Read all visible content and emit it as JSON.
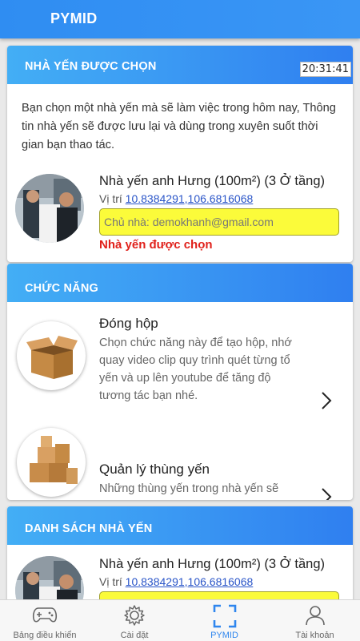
{
  "app": {
    "title": "PYMID"
  },
  "selected_card": {
    "header": "NHÀ YẾN ĐƯỢC CHỌN",
    "clock": "20:31:41",
    "intro": "Bạn chọn một nhà yến mà sẽ làm việc trong hôm nay, Thông tin nhà yến sẽ được lưu lại và dùng trong xuyên suốt thời gian bạn thao tác.",
    "house": {
      "name": "Nhà yến anh Hưng (100m²) (3 Ở tầng)",
      "location_label": "Vị trí",
      "lat": "10.8384291",
      "lng": "106.6816068",
      "owner": "Chủ nhà: demokhanh@gmail.com",
      "status": "Nhà yến được chọn"
    }
  },
  "features_card": {
    "header": "CHỨC NĂNG",
    "items": [
      {
        "title": "Đóng hộp",
        "desc": "Chọn chức năng này để tạo hộp, nhớ quay video clip quy trình quét từng tổ yến và up lên youtube để tăng độ tương tác bạn nhé.",
        "icon": "open-box-icon"
      },
      {
        "title": "Quản lý thùng yến",
        "desc": "Những thùng yến trong nhà yến sẽ được liệt kê ở đây",
        "icon": "stacked-boxes-icon"
      }
    ]
  },
  "list_card": {
    "header": "DANH SÁCH NHÀ YẾN",
    "house": {
      "name": "Nhà yến anh Hưng (100m²) (3 Ở tầng)",
      "location_label": "Vị trí",
      "lat": "10.8384291",
      "lng": "106.6816068"
    }
  },
  "tabbar": {
    "tabs": [
      {
        "label": "Bảng điều khiển",
        "icon": "gamepad-icon"
      },
      {
        "label": "Cài đặt",
        "icon": "gear-icon"
      },
      {
        "label": "PYMID",
        "icon": "scan-icon",
        "active": true
      },
      {
        "label": "Tài khoản",
        "icon": "user-icon"
      }
    ]
  },
  "colors": {
    "primary": "#2f86ee",
    "owner_bg": "#fbfb3a",
    "status_red": "#e0201a"
  }
}
